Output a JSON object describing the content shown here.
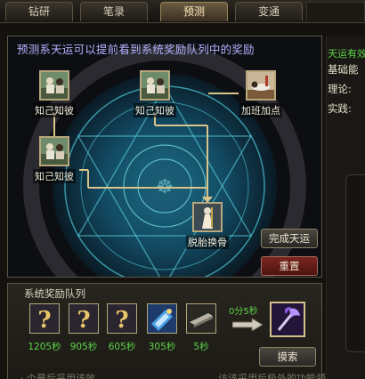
{
  "tabs": [
    {
      "label": "钻研",
      "active": false
    },
    {
      "label": "笔录",
      "active": false
    },
    {
      "label": "预测",
      "active": true
    },
    {
      "label": "变通",
      "active": false
    }
  ],
  "panel": {
    "title": "预测系天运可以提前看到系统奖励队列中的奖励",
    "nodes": [
      {
        "label": "知己知彼",
        "icon": "scholars-portrait-icon"
      },
      {
        "label": "知己知彼",
        "icon": "scholars-portrait-icon"
      },
      {
        "label": "加班加点",
        "icon": "sleeping-scholar-icon"
      },
      {
        "label": "知己知彼",
        "icon": "scholars-portrait-icon"
      },
      {
        "label": "脱胎换骨",
        "icon": "sage-figure-icon"
      }
    ],
    "complete_button": "完成天运",
    "reset_button": "重置"
  },
  "queue": {
    "title": "系统奖励队列",
    "slots": [
      {
        "time": "1205秒",
        "icon": "question-mark-icon"
      },
      {
        "time": "905秒",
        "icon": "question-mark-icon"
      },
      {
        "time": "605秒",
        "icon": "question-mark-icon"
      },
      {
        "time": "305秒",
        "icon": "blue-scroll-icon"
      },
      {
        "time": "5秒",
        "icon": "silver-ingot-icon"
      }
    ],
    "countdown": "0分5秒",
    "final_icon": "purple-axe-icon",
    "search_button": "摸索",
    "footer_left": "· 个最后采用该效",
    "footer_right": "访该采用后极外的功能领的"
  },
  "side": {
    "title": "天运有效",
    "rows": [
      "基础能",
      "理论:",
      "实践:"
    ]
  },
  "colors": {
    "accent_green": "#5dd34a",
    "title_violet": "#b4b2ff",
    "frame_gold": "#b7a77c"
  }
}
